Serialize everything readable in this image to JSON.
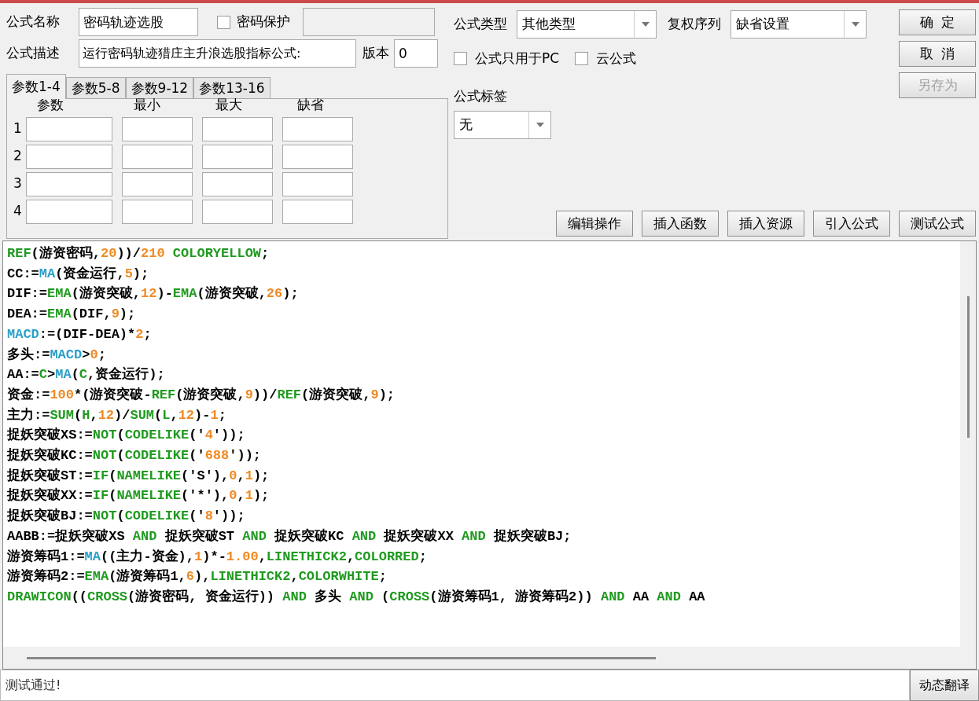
{
  "formula_name": {
    "label": "公式名称",
    "value": "密码轨迹选股"
  },
  "password_protect": {
    "label": "密码保护",
    "checked": false,
    "field_disabled": true
  },
  "formula_desc": {
    "label": "公式描述",
    "value": "运行密码轨迹猎庄主升浪选股指标公式:"
  },
  "version": {
    "label": "版本",
    "value": "0"
  },
  "param_tabs": [
    {
      "label": "参数1-4",
      "selected": true
    },
    {
      "label": "参数5-8",
      "selected": false
    },
    {
      "label": "参数9-12",
      "selected": false
    },
    {
      "label": "参数13-16",
      "selected": false
    }
  ],
  "param_columns": [
    "参数",
    "最小",
    "最大",
    "缺省"
  ],
  "param_rows": [
    "1",
    "2",
    "3",
    "4"
  ],
  "formula_type": {
    "label": "公式类型",
    "value": "其他类型"
  },
  "adjust_sequence": {
    "label": "复权序列",
    "value": "缺省设置"
  },
  "options": [
    {
      "label": "公式只用于PC",
      "checked": false
    },
    {
      "label": "云公式",
      "checked": false
    }
  ],
  "formula_tag": {
    "label": "公式标签",
    "value": "无"
  },
  "side_buttons": [
    {
      "label": "确  定",
      "disabled": false
    },
    {
      "label": "取  消",
      "disabled": false
    },
    {
      "label": "另存为",
      "disabled": true
    }
  ],
  "tool_buttons": [
    "编辑操作",
    "插入函数",
    "插入资源",
    "引入公式",
    "测试公式"
  ],
  "code_lines": [
    [
      {
        "t": "REF",
        "kind": "fn"
      },
      {
        "t": "(游资密码,",
        "kind": "p"
      },
      {
        "t": "20",
        "kind": "num"
      },
      {
        "t": "))/",
        "kind": "p"
      },
      {
        "t": "210",
        "kind": "num"
      },
      {
        "t": " COLORYELLOW",
        "kind": "fn"
      },
      {
        "t": ";",
        "kind": "p"
      }
    ],
    [
      {
        "t": "CC:=",
        "kind": "p"
      },
      {
        "t": "MA",
        "kind": "var"
      },
      {
        "t": "(资金运行,",
        "kind": "p"
      },
      {
        "t": "5",
        "kind": "num"
      },
      {
        "t": ");",
        "kind": "p"
      }
    ],
    [
      {
        "t": "DIF:=",
        "kind": "p"
      },
      {
        "t": "EMA",
        "kind": "fn"
      },
      {
        "t": "(游资突破,",
        "kind": "p"
      },
      {
        "t": "12",
        "kind": "num"
      },
      {
        "t": ")-",
        "kind": "p"
      },
      {
        "t": "EMA",
        "kind": "fn"
      },
      {
        "t": "(游资突破,",
        "kind": "p"
      },
      {
        "t": "26",
        "kind": "num"
      },
      {
        "t": ");",
        "kind": "p"
      }
    ],
    [
      {
        "t": "DEA:=",
        "kind": "p"
      },
      {
        "t": "EMA",
        "kind": "fn"
      },
      {
        "t": "(DIF,",
        "kind": "p"
      },
      {
        "t": "9",
        "kind": "num"
      },
      {
        "t": ");",
        "kind": "p"
      }
    ],
    [
      {
        "t": "MACD",
        "kind": "var"
      },
      {
        "t": ":=(DIF-DEA)*",
        "kind": "p"
      },
      {
        "t": "2",
        "kind": "num"
      },
      {
        "t": ";",
        "kind": "p"
      }
    ],
    [
      {
        "t": "多头:=",
        "kind": "p"
      },
      {
        "t": "MACD",
        "kind": "var"
      },
      {
        "t": ">",
        "kind": "p"
      },
      {
        "t": "0",
        "kind": "num"
      },
      {
        "t": ";",
        "kind": "p"
      }
    ],
    [
      {
        "t": "AA:=",
        "kind": "p"
      },
      {
        "t": "C",
        "kind": "fn"
      },
      {
        "t": ">",
        "kind": "p"
      },
      {
        "t": "MA",
        "kind": "var"
      },
      {
        "t": "(",
        "kind": "p"
      },
      {
        "t": "C",
        "kind": "fn"
      },
      {
        "t": ",资金运行);",
        "kind": "p"
      }
    ],
    [
      {
        "t": "资金:=",
        "kind": "p"
      },
      {
        "t": "100",
        "kind": "num"
      },
      {
        "t": "*(游资突破-",
        "kind": "p"
      },
      {
        "t": "REF",
        "kind": "fn"
      },
      {
        "t": "(游资突破,",
        "kind": "p"
      },
      {
        "t": "9",
        "kind": "num"
      },
      {
        "t": "))/",
        "kind": "p"
      },
      {
        "t": "REF",
        "kind": "fn"
      },
      {
        "t": "(游资突破,",
        "kind": "p"
      },
      {
        "t": "9",
        "kind": "num"
      },
      {
        "t": ");",
        "kind": "p"
      }
    ],
    [
      {
        "t": "主力:=",
        "kind": "p"
      },
      {
        "t": "SUM",
        "kind": "fn"
      },
      {
        "t": "(",
        "kind": "p"
      },
      {
        "t": "H",
        "kind": "fn"
      },
      {
        "t": ",",
        "kind": "p"
      },
      {
        "t": "12",
        "kind": "num"
      },
      {
        "t": ")/",
        "kind": "p"
      },
      {
        "t": "SUM",
        "kind": "fn"
      },
      {
        "t": "(",
        "kind": "p"
      },
      {
        "t": "L",
        "kind": "fn"
      },
      {
        "t": ",",
        "kind": "p"
      },
      {
        "t": "12",
        "kind": "num"
      },
      {
        "t": ")-",
        "kind": "p"
      },
      {
        "t": "1",
        "kind": "num"
      },
      {
        "t": ";",
        "kind": "p"
      }
    ],
    [
      {
        "t": "捉妖突破XS:=",
        "kind": "p"
      },
      {
        "t": "NOT",
        "kind": "fn"
      },
      {
        "t": "(",
        "kind": "p"
      },
      {
        "t": "CODELIKE",
        "kind": "fn"
      },
      {
        "t": "('",
        "kind": "p"
      },
      {
        "t": "4",
        "kind": "num"
      },
      {
        "t": "'));",
        "kind": "p"
      }
    ],
    [
      {
        "t": "捉妖突破KC:=",
        "kind": "p"
      },
      {
        "t": "NOT",
        "kind": "fn"
      },
      {
        "t": "(",
        "kind": "p"
      },
      {
        "t": "CODELIKE",
        "kind": "fn"
      },
      {
        "t": "('",
        "kind": "p"
      },
      {
        "t": "688",
        "kind": "num"
      },
      {
        "t": "'));",
        "kind": "p"
      }
    ],
    [
      {
        "t": "捉妖突破ST:=",
        "kind": "p"
      },
      {
        "t": "IF",
        "kind": "fn"
      },
      {
        "t": "(",
        "kind": "p"
      },
      {
        "t": "NAMELIKE",
        "kind": "fn"
      },
      {
        "t": "('S'),",
        "kind": "p"
      },
      {
        "t": "0",
        "kind": "num"
      },
      {
        "t": ",",
        "kind": "p"
      },
      {
        "t": "1",
        "kind": "num"
      },
      {
        "t": ");",
        "kind": "p"
      }
    ],
    [
      {
        "t": "捉妖突破XX:=",
        "kind": "p"
      },
      {
        "t": "IF",
        "kind": "fn"
      },
      {
        "t": "(",
        "kind": "p"
      },
      {
        "t": "NAMELIKE",
        "kind": "fn"
      },
      {
        "t": "('*'),",
        "kind": "p"
      },
      {
        "t": "0",
        "kind": "num"
      },
      {
        "t": ",",
        "kind": "p"
      },
      {
        "t": "1",
        "kind": "num"
      },
      {
        "t": ");",
        "kind": "p"
      }
    ],
    [
      {
        "t": "捉妖突破BJ:=",
        "kind": "p"
      },
      {
        "t": "NOT",
        "kind": "fn"
      },
      {
        "t": "(",
        "kind": "p"
      },
      {
        "t": "CODELIKE",
        "kind": "fn"
      },
      {
        "t": "('",
        "kind": "p"
      },
      {
        "t": "8",
        "kind": "num"
      },
      {
        "t": "'));",
        "kind": "p"
      }
    ],
    [
      {
        "t": "AABB:=捉妖突破XS ",
        "kind": "p"
      },
      {
        "t": "AND",
        "kind": "fn"
      },
      {
        "t": " 捉妖突破ST ",
        "kind": "p"
      },
      {
        "t": "AND",
        "kind": "fn"
      },
      {
        "t": " 捉妖突破KC ",
        "kind": "p"
      },
      {
        "t": "AND",
        "kind": "fn"
      },
      {
        "t": " 捉妖突破XX ",
        "kind": "p"
      },
      {
        "t": "AND",
        "kind": "fn"
      },
      {
        "t": " 捉妖突破BJ;",
        "kind": "p"
      }
    ],
    [
      {
        "t": "游资筹码1:=",
        "kind": "p"
      },
      {
        "t": "MA",
        "kind": "var"
      },
      {
        "t": "((主力-资金),",
        "kind": "p"
      },
      {
        "t": "1",
        "kind": "num"
      },
      {
        "t": ")*-",
        "kind": "p"
      },
      {
        "t": "1.00",
        "kind": "num"
      },
      {
        "t": ",",
        "kind": "p"
      },
      {
        "t": "LINETHICK2",
        "kind": "fn"
      },
      {
        "t": ",",
        "kind": "p"
      },
      {
        "t": "COLORRED",
        "kind": "fn"
      },
      {
        "t": ";",
        "kind": "p"
      }
    ],
    [
      {
        "t": "游资筹码2:=",
        "kind": "p"
      },
      {
        "t": "EMA",
        "kind": "fn"
      },
      {
        "t": "(游资筹码1,",
        "kind": "p"
      },
      {
        "t": "6",
        "kind": "num"
      },
      {
        "t": "),",
        "kind": "p"
      },
      {
        "t": "LINETHICK2",
        "kind": "fn"
      },
      {
        "t": ",",
        "kind": "p"
      },
      {
        "t": "COLORWHITE",
        "kind": "fn"
      },
      {
        "t": ";",
        "kind": "p"
      }
    ],
    [
      {
        "t": "DRAWICON",
        "kind": "fn"
      },
      {
        "t": "((",
        "kind": "p"
      },
      {
        "t": "CROSS",
        "kind": "fn"
      },
      {
        "t": "(游资密码, 资金运行)) ",
        "kind": "p"
      },
      {
        "t": "AND",
        "kind": "fn"
      },
      {
        "t": " 多头 ",
        "kind": "p"
      },
      {
        "t": "AND",
        "kind": "fn"
      },
      {
        "t": " (",
        "kind": "p"
      },
      {
        "t": "CROSS",
        "kind": "fn"
      },
      {
        "t": "(游资筹码1, 游资筹码2)) ",
        "kind": "p"
      },
      {
        "t": "AND",
        "kind": "fn"
      },
      {
        "t": " AA ",
        "kind": "p"
      },
      {
        "t": "AND",
        "kind": "fn"
      },
      {
        "t": " AA",
        "kind": "p"
      }
    ]
  ],
  "status": {
    "message": "测试通过!",
    "button": "动态翻译"
  }
}
